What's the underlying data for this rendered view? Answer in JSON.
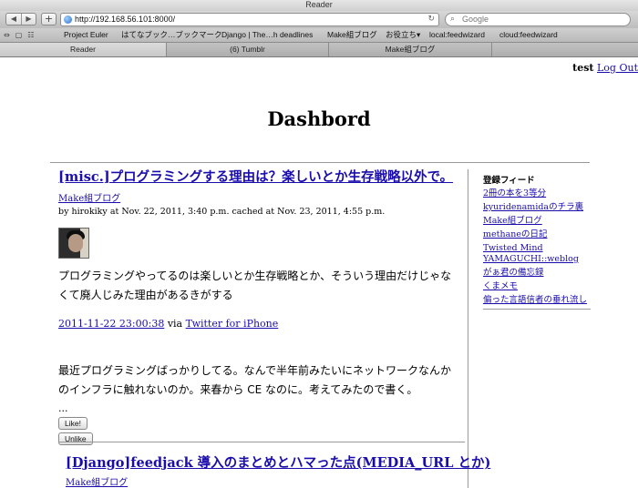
{
  "window": {
    "title": "Reader"
  },
  "toolbar": {
    "back": "◀",
    "forward": "▶",
    "add": "+",
    "url": "http://192.168.56.101:8000/",
    "reload": "↻",
    "search_placeholder": "Google"
  },
  "bookmarks": {
    "icons": [
      "⇔",
      "▢",
      "☷"
    ],
    "items": [
      "Project Euler",
      "はてなブック…ブックマーク",
      "Django | The…h deadlines",
      "Make組ブログ",
      "お役立ち▾",
      "local:feedwizard",
      "cloud:feedwizard"
    ]
  },
  "tabs": [
    "Reader",
    "(6) Tumblr",
    "Make組ブログ"
  ],
  "user": {
    "name": "test",
    "logout": "Log Out"
  },
  "page_title": "Dashbord",
  "post1": {
    "title": "[misc.]プログラミングする理由は？楽しいとか生存戦略以外で。",
    "source": "Make組ブログ",
    "meta": "by hirokiky at Nov. 22, 2011, 3:40 p.m. cached at Nov. 23, 2011, 4:55 p.m.",
    "body1": "プログラミングやってるのは楽しいとか生存戦略とか、そういう理由だけじゃなくて廃人じみた理由があるきがする",
    "timestamp": "2011-11-22 23:00:38",
    "via": "via",
    "client": "Twitter for iPhone",
    "body2": "最近プログラミングばっかりしてる。なんで半年前みたいにネットワークなんかのインフラに触れないのか。来春から CE なのに。考えてみたので書く。",
    "ellipsis": "...",
    "like": "Like!",
    "unlike": "Unlike"
  },
  "post2": {
    "title": "[Django]feedjack 導入のまとめとハマった点(MEDIA_URL とか)",
    "source": "Make組ブログ"
  },
  "sidebar": {
    "heading": "登録フィード",
    "feeds": [
      "2冊の本を3等分",
      "kyuridenamidaのチラ裏",
      "Make組ブログ",
      "methaneの日記",
      "Twisted Mind",
      "YAMAGUCHI::weblog",
      "がぁ君の備忘録",
      "くまメモ",
      "偏った言語信者の垂れ流し"
    ]
  }
}
